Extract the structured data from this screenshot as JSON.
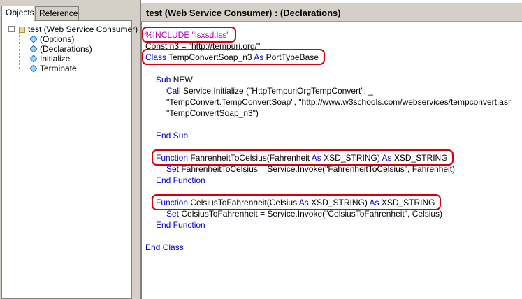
{
  "left_pane": {
    "tabs": [
      {
        "label": "Objects",
        "active": true
      },
      {
        "label": "Reference",
        "active": false
      }
    ],
    "tree": {
      "root": "test (Web Service Consumer)",
      "children": [
        "(Options)",
        "(Declarations)",
        "Initialize",
        "Terminate"
      ]
    }
  },
  "editor": {
    "title": "test (Web Service Consumer) : (Declarations)",
    "lines": [
      {
        "indent": 0,
        "parts": [
          {
            "t": "%INCLUDE \"lsxsd.lss\"",
            "c": "pp"
          }
        ]
      },
      {
        "indent": 0,
        "parts": [
          {
            "t": "Const n3 = \"http://tempuri.org/\"",
            "c": ""
          }
        ]
      },
      {
        "indent": 0,
        "parts": [
          {
            "t": "Class",
            "c": "kw"
          },
          {
            "t": " TempConvertSoap_n3 ",
            "c": ""
          },
          {
            "t": "As",
            "c": "kw"
          },
          {
            "t": " PortTypeBase",
            "c": ""
          }
        ]
      },
      {
        "indent": 0,
        "parts": []
      },
      {
        "indent": 1,
        "parts": [
          {
            "t": "Sub",
            "c": "kw"
          },
          {
            "t": " NEW",
            "c": ""
          }
        ]
      },
      {
        "indent": 2,
        "parts": [
          {
            "t": "Call",
            "c": "kw"
          },
          {
            "t": " Service.Initialize (\"HttpTempuriOrgTempConvert\", _",
            "c": ""
          }
        ]
      },
      {
        "indent": 2,
        "parts": [
          {
            "t": "\"TempConvert.TempConvertSoap\", \"http://www.w3schools.com/webservices/tempconvert.asr",
            "c": ""
          }
        ]
      },
      {
        "indent": 2,
        "parts": [
          {
            "t": "\"TempConvertSoap_n3\")",
            "c": ""
          }
        ]
      },
      {
        "indent": 0,
        "parts": []
      },
      {
        "indent": 1,
        "parts": [
          {
            "t": "End Sub",
            "c": "kw"
          }
        ]
      },
      {
        "indent": 0,
        "parts": []
      },
      {
        "indent": 1,
        "parts": [
          {
            "t": "Function",
            "c": "kw"
          },
          {
            "t": " FahrenheitToCelsius(Fahrenheit ",
            "c": ""
          },
          {
            "t": "As",
            "c": "kw"
          },
          {
            "t": " XSD_STRING) ",
            "c": ""
          },
          {
            "t": "As",
            "c": "kw"
          },
          {
            "t": " XSD_STRING",
            "c": ""
          }
        ]
      },
      {
        "indent": 2,
        "parts": [
          {
            "t": "Set",
            "c": "kw"
          },
          {
            "t": " FahrenheitToCelsius = Service.Invoke(\"FahrenheitToCelsius\", Fahrenheit)",
            "c": ""
          }
        ]
      },
      {
        "indent": 1,
        "parts": [
          {
            "t": "End Function",
            "c": "kw"
          }
        ]
      },
      {
        "indent": 0,
        "parts": []
      },
      {
        "indent": 1,
        "parts": [
          {
            "t": "Function",
            "c": "kw"
          },
          {
            "t": " CelsiusToFahrenheit(Celsius ",
            "c": ""
          },
          {
            "t": "As",
            "c": "kw"
          },
          {
            "t": " XSD_STRING) ",
            "c": ""
          },
          {
            "t": "As",
            "c": "kw"
          },
          {
            "t": " XSD_STRING",
            "c": ""
          }
        ]
      },
      {
        "indent": 2,
        "parts": [
          {
            "t": "Set",
            "c": "kw"
          },
          {
            "t": " CelsiusToFahrenheit = Service.Invoke(\"CelsiusToFahrenheit\", Celsius)",
            "c": ""
          }
        ]
      },
      {
        "indent": 1,
        "parts": [
          {
            "t": "End Function",
            "c": "kw"
          }
        ]
      },
      {
        "indent": 0,
        "parts": []
      },
      {
        "indent": 0,
        "parts": [
          {
            "t": "End Class",
            "c": "kw"
          }
        ]
      }
    ],
    "highlighted_lines": [
      0,
      2,
      11,
      15
    ]
  },
  "colors": {
    "keyword": "#0000cc",
    "preprocessor": "#b000b0",
    "annotation": "#d00010"
  }
}
